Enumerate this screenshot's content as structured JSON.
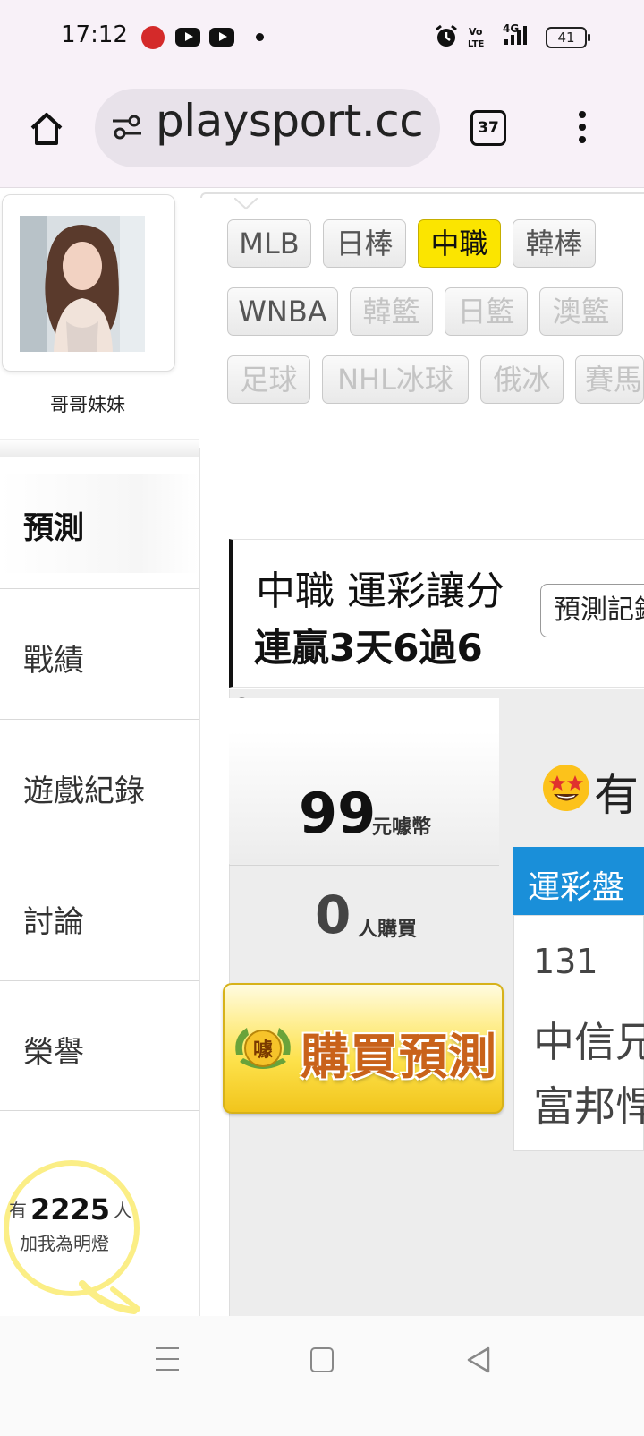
{
  "status_bar": {
    "time": "17:12",
    "battery": "41",
    "network_icons": [
      "alarm-icon",
      "volte-icon",
      "4g-signal-icon"
    ]
  },
  "browser": {
    "url": "playsport.cc",
    "tab_count": "37",
    "icons": [
      "home-icon",
      "tune-icon",
      "more-vert-icon"
    ]
  },
  "profile": {
    "username": "哥哥妹妹"
  },
  "sidebar": {
    "active": "預測",
    "items": [
      {
        "label": "戰績"
      },
      {
        "label": "遊戲紀錄"
      },
      {
        "label": "討論"
      },
      {
        "label": "榮譽"
      }
    ]
  },
  "fans": {
    "prefix": "有",
    "count": "2225",
    "suffix": "人",
    "line2": "加我為明燈"
  },
  "league_tags": [
    {
      "label": "MLB",
      "state": "normal"
    },
    {
      "label": "日棒",
      "state": "normal"
    },
    {
      "label": "中職",
      "state": "active"
    },
    {
      "label": "韓棒",
      "state": "normal"
    },
    {
      "label": "WNBA",
      "state": "normal"
    },
    {
      "label": "韓籃",
      "state": "dim"
    },
    {
      "label": "日籃",
      "state": "dim"
    },
    {
      "label": "澳籃",
      "state": "dim"
    },
    {
      "label": "足球",
      "state": "dim"
    },
    {
      "label": "NHL冰球",
      "state": "dim"
    },
    {
      "label": "俄冰",
      "state": "dim"
    },
    {
      "label": "賽馬",
      "state": "dim"
    }
  ],
  "prediction": {
    "title": "中職 運彩讓分",
    "streak": "連贏3天6過6",
    "record_button": "預測記錄",
    "price": "99",
    "price_unit": "元噱幣",
    "buyers": "0",
    "buyers_unit": "人購買",
    "buy_button": "購買預測",
    "emblem_char": "噱",
    "right_text": "有",
    "tab_label": "運彩盤",
    "game_number": "131",
    "team_home": "中信兄弟",
    "team_away": "富邦悍將"
  },
  "colors": {
    "active_tag": "#fbe500",
    "bet_tab": "#1a8fd9",
    "buy_text": "#c9621a",
    "fans_ring": "#fbee86"
  }
}
